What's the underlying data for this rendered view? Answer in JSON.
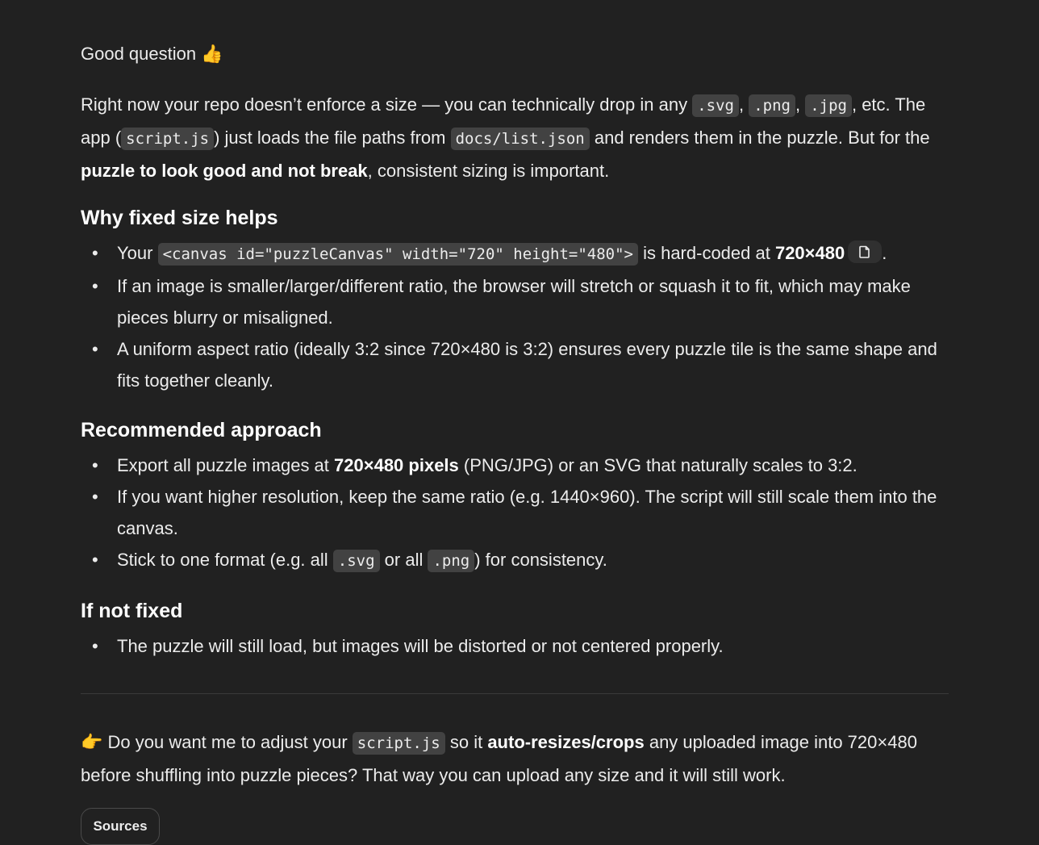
{
  "greeting": "Good question 👍",
  "intro": {
    "t1": "Right now your repo doesn’t enforce a size — you can technically drop in any ",
    "c_svg": ".svg",
    "sep1": ", ",
    "c_png": ".png",
    "sep2": ", ",
    "c_jpg": ".jpg",
    "t2": ", etc. The app (",
    "c_script": "script.js",
    "t3": ") just loads the file paths from ",
    "c_list": "docs/list.json",
    "t4": " and renders them in the puzzle. But for the ",
    "bold": "puzzle to look good and not break",
    "t5": ", consistent sizing is important."
  },
  "why": {
    "heading": "Why fixed size helps",
    "b1_pre": "Your ",
    "b1_code": "<canvas id=\"puzzleCanvas\" width=\"720\" height=\"480\">",
    "b1_mid": " is hard-coded at ",
    "b1_bold": "720×480",
    "b1_end": ".",
    "b2": "If an image is smaller/larger/different ratio, the browser will stretch or squash it to fit, which may make pieces blurry or misaligned.",
    "b3": "A uniform aspect ratio (ideally 3:2 since 720×480 is 3:2) ensures every puzzle tile is the same shape and fits together cleanly."
  },
  "rec": {
    "heading": "Recommended approach",
    "b1_pre": "Export all puzzle images at ",
    "b1_bold": "720×480 pixels",
    "b1_post": " (PNG/JPG) or an SVG that naturally scales to 3:2.",
    "b2": "If you want higher resolution, keep the same ratio (e.g. 1440×960). The script will still scale them into the canvas.",
    "b3_pre": "Stick to one format (e.g. all ",
    "b3_c1": ".svg",
    "b3_mid": " or all ",
    "b3_c2": ".png",
    "b3_post": ") for consistency."
  },
  "notfixed": {
    "heading": "If not fixed",
    "b1": "The puzzle will still load, but images will be distorted or not centered properly."
  },
  "cta": {
    "t1": "👉 Do you want me to adjust your ",
    "code": "script.js",
    "t2": " so it ",
    "bold": "auto-resizes/crops",
    "t3": " any uploaded image into 720×480 before shuffling into puzzle pieces? That way you can upload any size and it will still work."
  },
  "sources_label": "Sources",
  "icons": {
    "copy": "copy-icon"
  }
}
